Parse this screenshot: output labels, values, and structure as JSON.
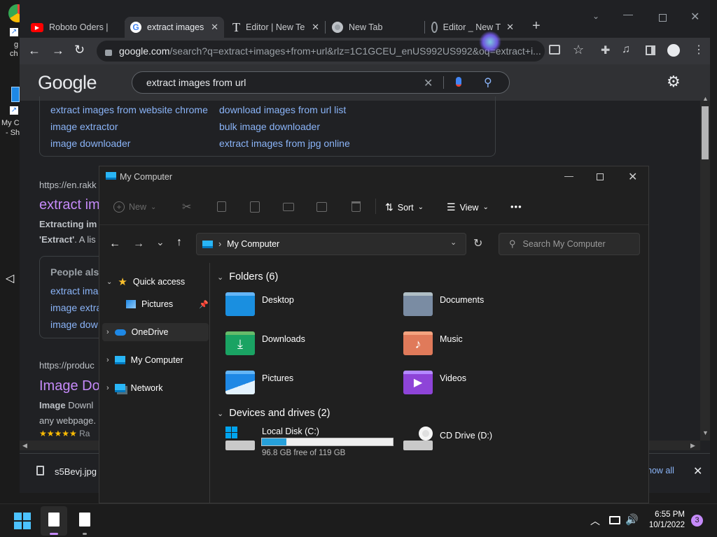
{
  "desktop": {
    "icons": [
      {
        "label": "g",
        "label2": "ch",
        "icon": "chrome-icon"
      },
      {
        "label": "My C",
        "label2": "- Sh",
        "icon": "computer-shortcut-icon"
      }
    ]
  },
  "browser": {
    "tabs": [
      {
        "title": "Roboto Oders |",
        "icon": "youtube-icon"
      },
      {
        "title": "extract images",
        "icon": "google-icon",
        "active": true
      },
      {
        "title": "Editor | New Te",
        "icon": "text-editor-icon"
      },
      {
        "title": "New Tab",
        "icon": "chrome-icon"
      },
      {
        "title": "Editor _ New T",
        "icon": "globe-icon"
      }
    ],
    "url_host": "google.com",
    "url_rest": "/search?q=extract+images+from+url&rlz=1C1GCEU_enUS992US992&oq=extract+i...",
    "search_query": "extract images from url",
    "related": [
      [
        "extract images from website chrome",
        "download images from url list"
      ],
      [
        "image extractor",
        "bulk image downloader"
      ],
      [
        "image downloader",
        "extract images from jpg online"
      ]
    ],
    "results": [
      {
        "url": "https://en.rakk",
        "title": "extract im",
        "snippet_bold": "Extracting im",
        "snippet2_bold": "'Extract'",
        "snippet2": ". A lis"
      },
      {
        "url": "https://produc",
        "title": "Image Do",
        "snippet_bold": "Image",
        "snippet": " Downl",
        "snippet2": "any webpage.",
        "rating": "★★★★★",
        "rating_text": "Ra"
      }
    ],
    "people_also": {
      "heading": "People als",
      "items": [
        "extract ima",
        "image extra",
        "image dow"
      ]
    },
    "download": {
      "filename": "s5Bevj.jpg",
      "show_all": "how all"
    }
  },
  "explorer": {
    "title": "My Computer",
    "toolbar": {
      "new": "New",
      "sort": "Sort",
      "view": "View",
      "more": "•••"
    },
    "address": "My Computer",
    "search_placeholder": "Search My Computer",
    "nav": {
      "quick_access": "Quick access",
      "pictures": "Pictures",
      "onedrive": "OneDrive",
      "my_computer": "My Computer",
      "network": "Network"
    },
    "folders_header": "Folders (6)",
    "folders": [
      {
        "name": "Desktop",
        "icon": "desktop-folder-icon"
      },
      {
        "name": "Documents",
        "icon": "documents-folder-icon"
      },
      {
        "name": "Downloads",
        "icon": "downloads-folder-icon"
      },
      {
        "name": "Music",
        "icon": "music-folder-icon"
      },
      {
        "name": "Pictures",
        "icon": "pictures-folder-icon"
      },
      {
        "name": "Videos",
        "icon": "videos-folder-icon"
      }
    ],
    "drives_header": "Devices and drives (2)",
    "drives": [
      {
        "name": "Local Disk (C:)",
        "free": "96.8 GB free of 119 GB",
        "used_fraction": 0.187,
        "icon": "windows-drive-icon"
      },
      {
        "name": "CD Drive (D:)",
        "icon": "cd-drive-icon"
      }
    ]
  },
  "taskbar": {
    "time": "6:55 PM",
    "date": "10/1/2022",
    "notifications": "3"
  },
  "colors": {
    "accent": "#0078d4",
    "link": "#8ab4f8",
    "visited": "#c58af9",
    "drive_bar": "#26a0da"
  }
}
